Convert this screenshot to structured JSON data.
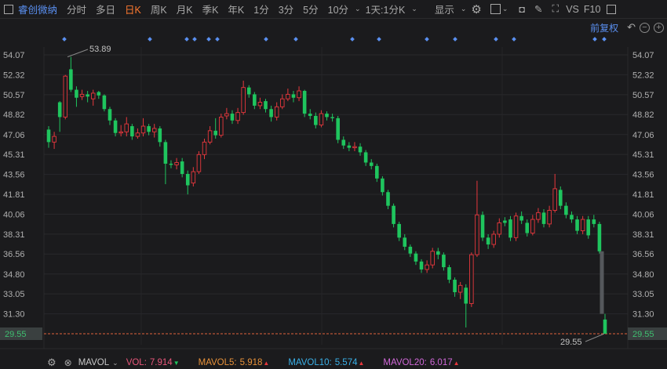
{
  "toolbar": {
    "stock_name": "睿创微纳",
    "periods": [
      "分时",
      "多日",
      "日K",
      "周K",
      "月K",
      "季K",
      "年K",
      "1分",
      "3分",
      "5分",
      "10分"
    ],
    "active_period": "日K",
    "multi_period": "1天:1分K",
    "display": "显示",
    "right": [
      "VS",
      "F10"
    ],
    "icons": [
      "sidebar-icon",
      "chevron-down-icon",
      "settings-icon",
      "layout-icon",
      "camera-icon",
      "pencil-icon",
      "fullscreen-icon",
      "panel-icon"
    ]
  },
  "subbar": {
    "adjust": "前复权",
    "icons": [
      "undo-icon",
      "zoom-out-icon",
      "zoom-in-icon"
    ]
  },
  "colors": {
    "up": "#e8383d",
    "down": "#1fc55e",
    "marker": "#5a8ff0",
    "current_line": "#e0603a",
    "name": "#5a8ff0",
    "active": "#ff7a30"
  },
  "chart_data": {
    "type": "candlestick",
    "y_ticks": [
      "54.07",
      "52.32",
      "50.57",
      "48.82",
      "47.06",
      "45.31",
      "43.56",
      "41.81",
      "40.06",
      "38.31",
      "36.56",
      "34.80",
      "33.05",
      "31.30",
      "29.55"
    ],
    "ylim": [
      29.55,
      54.07
    ],
    "max_label": "53.89",
    "min_label": "29.55",
    "current_price": "29.55",
    "ohlc_format": "[open, close, high, low]",
    "candles": [
      [
        47.5,
        46.4,
        47.8,
        45.9
      ],
      [
        46.4,
        46.9,
        47.3,
        45.8
      ],
      [
        49.9,
        48.6,
        50.0,
        47.3
      ],
      [
        48.6,
        52.2,
        52.3,
        48.4
      ],
      [
        52.8,
        51.0,
        53.89,
        50.8
      ],
      [
        51.0,
        50.3,
        51.3,
        49.5
      ],
      [
        50.4,
        50.6,
        51.0,
        50.1
      ],
      [
        50.6,
        50.4,
        50.9,
        49.9
      ],
      [
        50.2,
        50.7,
        51.0,
        49.6
      ],
      [
        50.8,
        50.5,
        50.9,
        50.2
      ],
      [
        50.5,
        49.3,
        50.6,
        49.1
      ],
      [
        49.3,
        48.3,
        49.5,
        47.9
      ],
      [
        48.3,
        47.2,
        48.5,
        46.9
      ],
      [
        47.2,
        47.3,
        47.9,
        46.9
      ],
      [
        47.3,
        48.0,
        48.6,
        46.9
      ],
      [
        47.8,
        46.9,
        48.0,
        46.6
      ],
      [
        46.9,
        47.2,
        47.6,
        46.7
      ],
      [
        47.2,
        47.8,
        48.5,
        46.9
      ],
      [
        47.8,
        47.3,
        48.0,
        47.0
      ],
      [
        47.3,
        47.6,
        48.0,
        46.8
      ],
      [
        47.6,
        46.4,
        47.8,
        46.0
      ],
      [
        46.4,
        44.5,
        46.6,
        42.7
      ],
      [
        44.5,
        44.4,
        44.8,
        44.1
      ],
      [
        44.4,
        44.6,
        45.0,
        44.0
      ],
      [
        44.7,
        43.6,
        45.0,
        43.3
      ],
      [
        43.6,
        42.6,
        43.9,
        41.8
      ],
      [
        42.8,
        43.8,
        44.2,
        42.5
      ],
      [
        43.8,
        45.3,
        45.6,
        43.6
      ],
      [
        45.3,
        46.4,
        46.7,
        44.9
      ],
      [
        46.4,
        47.4,
        47.8,
        46.2
      ],
      [
        47.4,
        47.0,
        48.5,
        46.7
      ],
      [
        47.0,
        48.6,
        48.9,
        46.8
      ],
      [
        48.7,
        48.9,
        49.4,
        48.4
      ],
      [
        48.9,
        48.3,
        49.2,
        48.0
      ],
      [
        48.3,
        49.0,
        49.4,
        48.0
      ],
      [
        49.0,
        51.2,
        51.8,
        48.8
      ],
      [
        51.2,
        50.6,
        51.4,
        50.3
      ],
      [
        50.6,
        49.6,
        50.8,
        49.3
      ],
      [
        49.6,
        49.9,
        50.3,
        49.3
      ],
      [
        50.0,
        49.3,
        50.2,
        49.0
      ],
      [
        49.3,
        48.6,
        49.6,
        48.2
      ],
      [
        48.6,
        49.5,
        49.9,
        48.3
      ],
      [
        49.5,
        50.2,
        50.6,
        49.3
      ],
      [
        50.2,
        50.6,
        51.1,
        50.0
      ],
      [
        50.6,
        50.3,
        50.9,
        49.9
      ],
      [
        50.3,
        50.9,
        51.3,
        50.0
      ],
      [
        50.9,
        48.9,
        51.0,
        48.6
      ],
      [
        48.9,
        48.7,
        49.3,
        48.4
      ],
      [
        48.7,
        47.9,
        49.0,
        47.6
      ],
      [
        47.9,
        48.9,
        49.2,
        47.7
      ],
      [
        48.9,
        48.6,
        49.1,
        48.3
      ],
      [
        48.6,
        48.5,
        48.9,
        48.2
      ],
      [
        48.5,
        46.6,
        48.7,
        46.3
      ],
      [
        46.6,
        46.1,
        46.9,
        45.8
      ],
      [
        46.1,
        45.9,
        46.4,
        45.6
      ],
      [
        45.9,
        46.0,
        46.4,
        45.6
      ],
      [
        46.0,
        45.5,
        46.3,
        45.2
      ],
      [
        45.5,
        44.6,
        45.7,
        44.3
      ],
      [
        44.6,
        44.3,
        44.9,
        44.0
      ],
      [
        44.3,
        43.2,
        44.5,
        42.9
      ],
      [
        43.2,
        42.0,
        43.4,
        41.7
      ],
      [
        42.0,
        40.8,
        42.2,
        40.5
      ],
      [
        40.8,
        39.2,
        41.0,
        38.9
      ],
      [
        39.2,
        38.0,
        39.4,
        37.7
      ],
      [
        38.0,
        37.2,
        38.3,
        36.9
      ],
      [
        37.2,
        36.6,
        37.4,
        36.3
      ],
      [
        36.6,
        35.9,
        36.8,
        35.6
      ],
      [
        35.9,
        35.2,
        36.1,
        34.9
      ],
      [
        35.2,
        35.6,
        36.0,
        34.9
      ],
      [
        35.6,
        36.8,
        37.1,
        35.3
      ],
      [
        36.8,
        36.5,
        37.1,
        36.1
      ],
      [
        36.5,
        35.4,
        36.7,
        35.1
      ],
      [
        35.4,
        34.3,
        35.6,
        34.0
      ],
      [
        34.3,
        33.2,
        34.5,
        32.8
      ],
      [
        33.2,
        33.8,
        34.1,
        32.6
      ],
      [
        33.6,
        32.2,
        33.9,
        30.1
      ],
      [
        32.2,
        36.5,
        36.7,
        31.9
      ],
      [
        36.5,
        40.0,
        43.0,
        36.3
      ],
      [
        40.0,
        38.0,
        40.3,
        37.7
      ],
      [
        38.0,
        37.4,
        38.3,
        37.0
      ],
      [
        37.4,
        38.3,
        38.6,
        37.1
      ],
      [
        38.3,
        39.3,
        39.7,
        38.0
      ],
      [
        39.5,
        39.3,
        39.8,
        39.0
      ],
      [
        39.6,
        38.0,
        39.9,
        37.7
      ],
      [
        38.0,
        39.9,
        40.2,
        37.7
      ],
      [
        39.9,
        39.5,
        40.3,
        39.2
      ],
      [
        39.3,
        38.4,
        39.6,
        38.1
      ],
      [
        38.4,
        39.6,
        40.0,
        38.2
      ],
      [
        39.6,
        40.2,
        40.6,
        39.3
      ],
      [
        40.2,
        39.2,
        40.5,
        38.9
      ],
      [
        39.2,
        40.4,
        40.8,
        38.9
      ],
      [
        40.4,
        42.3,
        43.6,
        40.2
      ],
      [
        42.2,
        40.8,
        42.5,
        40.5
      ],
      [
        40.8,
        40.0,
        41.1,
        39.7
      ],
      [
        40.0,
        39.6,
        40.3,
        39.3
      ],
      [
        39.6,
        38.6,
        39.9,
        38.3
      ],
      [
        38.6,
        39.6,
        39.9,
        38.3
      ],
      [
        39.6,
        38.2,
        39.9,
        37.9
      ],
      [
        39.6,
        39.2,
        40.0,
        38.9
      ],
      [
        39.2,
        36.8,
        39.4,
        36.6
      ],
      [
        30.8,
        29.55,
        31.3,
        29.55
      ]
    ],
    "gap_bar": [
      36.8,
      31.3
    ],
    "event_markers": 17
  },
  "bottom": {
    "indicator": "MAVOL",
    "vol": {
      "label": "VOL:",
      "value": "7.914",
      "dir": "down",
      "color": "#e8567a"
    },
    "mavol5": {
      "label": "MAVOL5:",
      "value": "5.918",
      "dir": "up",
      "color": "#e8923a"
    },
    "mavol10": {
      "label": "MAVOL10:",
      "value": "5.574",
      "dir": "up",
      "color": "#3ab0e8"
    },
    "mavol20": {
      "label": "MAVOL20:",
      "value": "6.017",
      "dir": "up",
      "color": "#d068d8"
    }
  }
}
